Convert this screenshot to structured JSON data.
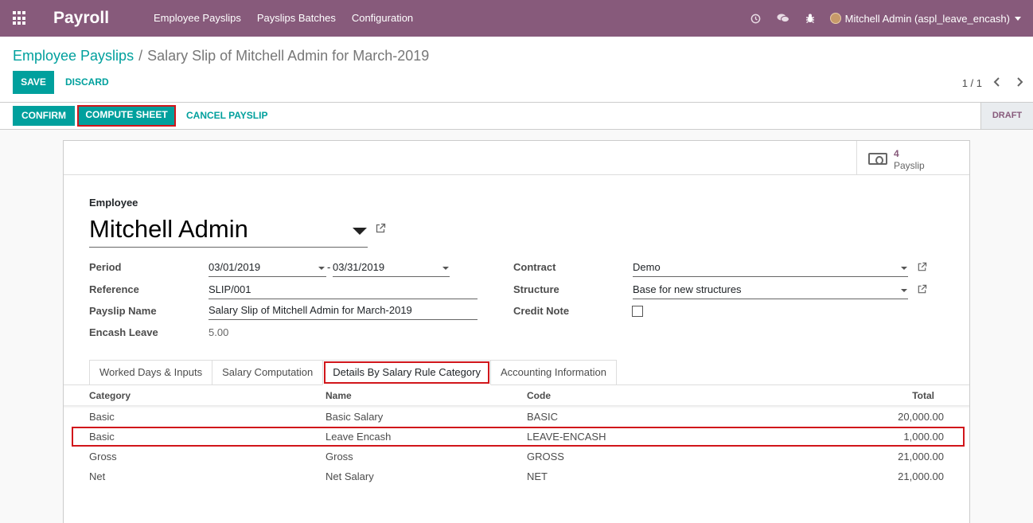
{
  "navbar": {
    "brand": "Payroll",
    "menu": [
      "Employee Payslips",
      "Payslips Batches",
      "Configuration"
    ],
    "user": "Mitchell Admin (aspl_leave_encash)",
    "icons": [
      "clock-icon",
      "chat-icon",
      "bug-icon"
    ]
  },
  "breadcrumb": {
    "parent": "Employee Payslips",
    "separator": "/",
    "current": "Salary Slip of Mitchell Admin for March-2019"
  },
  "toolbar": {
    "save": "SAVE",
    "discard": "DISCARD",
    "pager": "1 / 1"
  },
  "statusbar": {
    "confirm": "CONFIRM",
    "compute": "COMPUTE SHEET",
    "cancel": "CANCEL PAYSLIP",
    "state": "DRAFT"
  },
  "smart_button": {
    "value": "4",
    "label": "Payslip"
  },
  "form": {
    "employee_label": "Employee",
    "employee": "Mitchell Admin",
    "period_label": "Period",
    "date_from": "03/01/2019",
    "date_sep": "-",
    "date_to": "03/31/2019",
    "reference_label": "Reference",
    "reference": "SLIP/001",
    "payslip_name_label": "Payslip Name",
    "payslip_name": "Salary Slip of Mitchell Admin for March-2019",
    "encash_label": "Encash Leave",
    "encash": "5.00",
    "contract_label": "Contract",
    "contract": "Demo",
    "structure_label": "Structure",
    "structure": "Base for new structures",
    "credit_note_label": "Credit Note",
    "credit_note": false
  },
  "tabs": [
    "Worked Days & Inputs",
    "Salary Computation",
    "Details By Salary Rule Category",
    "Accounting Information"
  ],
  "active_tab": 2,
  "table": {
    "headers": [
      "Category",
      "Name",
      "Code",
      "Total"
    ],
    "rows": [
      {
        "category": "Basic",
        "name": "Basic Salary",
        "code": "BASIC",
        "total": "20,000.00"
      },
      {
        "category": "Basic",
        "name": "Leave Encash",
        "code": "LEAVE-ENCASH",
        "total": "1,000.00"
      },
      {
        "category": "Gross",
        "name": "Gross",
        "code": "GROSS",
        "total": "21,000.00"
      },
      {
        "category": "Net",
        "name": "Net Salary",
        "code": "NET",
        "total": "21,000.00"
      }
    ]
  },
  "colors": {
    "navbar": "#875a7b",
    "primary": "#00a09d",
    "highlight": "#d1161b"
  }
}
